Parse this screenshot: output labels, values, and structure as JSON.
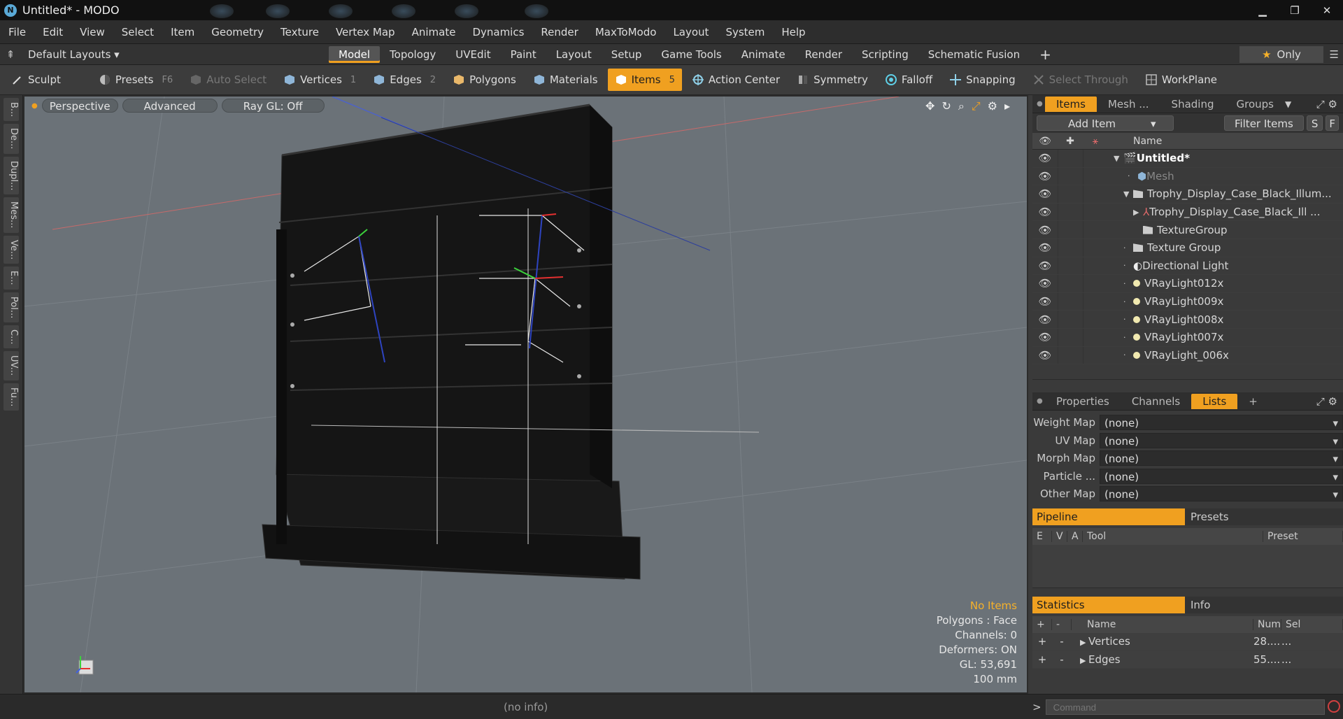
{
  "window": {
    "title": "Untitled* - MODO",
    "logo": "N"
  },
  "menu": [
    "File",
    "Edit",
    "View",
    "Select",
    "Item",
    "Geometry",
    "Texture",
    "Vertex Map",
    "Animate",
    "Dynamics",
    "Render",
    "MaxToModo",
    "Layout",
    "System",
    "Help"
  ],
  "layout_bar": {
    "layout_select": "Default Layouts",
    "tabs": [
      "Model",
      "Topology",
      "UVEdit",
      "Paint",
      "Layout",
      "Setup",
      "Game Tools",
      "Animate",
      "Render",
      "Scripting",
      "Schematic Fusion"
    ],
    "active_tab": "Model",
    "plus": "+",
    "only_label": "Only"
  },
  "toolbar": {
    "sculpt": "Sculpt",
    "presets": "Presets",
    "presets_key": "F6",
    "auto_select": "Auto Select",
    "vertices": "Vertices",
    "vertices_key": "1",
    "edges": "Edges",
    "edges_key": "2",
    "polygons": "Polygons",
    "materials": "Materials",
    "items": "Items",
    "items_key": "5",
    "action_center": "Action Center",
    "symmetry": "Symmetry",
    "falloff": "Falloff",
    "snapping": "Snapping",
    "select_through": "Select Through",
    "workplane": "WorkPlane"
  },
  "left_tabs": [
    "B...",
    "De...",
    "Dupl...",
    "Mes...",
    "Ve...",
    "E...",
    "Pol...",
    "C...",
    "UV...",
    "Fu..."
  ],
  "viewport": {
    "view_mode": "Perspective",
    "advanced": "Advanced",
    "raygl": "Ray GL: Off",
    "stats": {
      "selection": "No Items",
      "polygons": "Polygons : Face",
      "channels": "Channels: 0",
      "deformers": "Deformers: ON",
      "gl": "GL: 53,691",
      "unit": "100 mm"
    }
  },
  "items_panel": {
    "tabs": [
      "Items",
      "Mesh ...",
      "Shading",
      "Groups"
    ],
    "active_tab": "Items",
    "add_item": "Add Item",
    "filter_items": "Filter Items",
    "s_btn": "S",
    "f_btn": "F",
    "name_header": "Name",
    "rows": [
      {
        "label": "Untitled*",
        "kind": "scene"
      },
      {
        "label": "Mesh",
        "kind": "mesh"
      },
      {
        "label": "Trophy_Display_Case_Black_Illum...",
        "kind": "group"
      },
      {
        "label": "Trophy_Display_Case_Black_Ill ...",
        "kind": "locator"
      },
      {
        "label": "TextureGroup",
        "kind": "group"
      },
      {
        "label": "Texture Group",
        "kind": "group"
      },
      {
        "label": "Directional Light",
        "kind": "light"
      },
      {
        "label": "VRayLight012x",
        "kind": "dot"
      },
      {
        "label": "VRayLight009x",
        "kind": "dot"
      },
      {
        "label": "VRayLight008x",
        "kind": "dot"
      },
      {
        "label": "VRayLight007x",
        "kind": "dot"
      },
      {
        "label": "VRayLight_006x",
        "kind": "dot"
      }
    ]
  },
  "props_panel": {
    "tabs": [
      "Properties",
      "Channels",
      "Lists"
    ],
    "active_tab": "Lists",
    "plus": "+",
    "maps": [
      {
        "label": "Weight Map",
        "value": "(none)"
      },
      {
        "label": "UV Map",
        "value": "(none)"
      },
      {
        "label": "Morph Map",
        "value": "(none)"
      },
      {
        "label": "Particle ...",
        "value": "(none)"
      },
      {
        "label": "Other Map",
        "value": "(none)"
      }
    ],
    "pipeline": "Pipeline",
    "presets": "Presets",
    "pipeline_cols": [
      "E",
      "V",
      "A",
      "Tool",
      "Preset"
    ],
    "statistics": "Statistics",
    "info": "Info",
    "stat_cols": [
      "+",
      "-",
      "Name",
      "Num",
      "Sel"
    ],
    "stat_rows": [
      {
        "plus": "+",
        "minus": "-",
        "name": "Vertices",
        "num": "28....",
        "sel": "..."
      },
      {
        "plus": "+",
        "minus": "-",
        "name": "Edges",
        "num": "55....",
        "sel": "..."
      }
    ]
  },
  "status": {
    "no_info": "(no info)",
    "command_placeholder": "Command",
    "prompt": ">"
  }
}
